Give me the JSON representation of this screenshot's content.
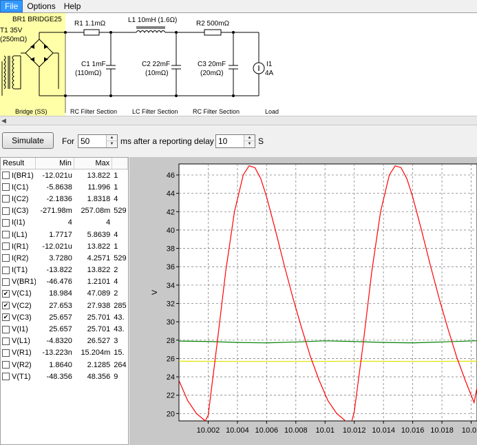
{
  "menu": {
    "file": "File",
    "options": "Options",
    "help": "Help"
  },
  "schematic": {
    "bridge_label": "BR1 BRIDGE25",
    "t1_voltage": "T1 35V",
    "t1_resistance": "(250mΩ)",
    "r1": "R1 1.1mΩ",
    "l1": "L1 10mH (1.6Ω)",
    "r2": "R2 500mΩ",
    "c1_value": "C1 1mF",
    "c1_esr": "(110mΩ)",
    "c2_value": "C2 22mF",
    "c2_esr": "(10mΩ)",
    "c3_value": "C3 20mF",
    "c3_esr": "(20mΩ)",
    "i1_name": "I1",
    "i1_value": "4A",
    "section_bridge": "Bridge (SS)",
    "section_rc1": "RC Filter Section",
    "section_lc": "LC Filter Section",
    "section_rc2": "RC Filter Section",
    "section_load": "Load"
  },
  "controls": {
    "simulate": "Simulate",
    "for_label": "For",
    "duration": "50",
    "ms_label": "ms",
    "delay_label": "after a reporting delay of",
    "delay": "10",
    "s_label": "S"
  },
  "results": {
    "headers": {
      "name": "Result",
      "min": "Min",
      "max": "Max"
    },
    "rows": [
      {
        "name": "I(BR1)",
        "min": "-12.021u",
        "max": "13.822",
        "extra": "1",
        "checked": false
      },
      {
        "name": "I(C1)",
        "min": "-5.8638",
        "max": "11.996",
        "extra": "1",
        "checked": false
      },
      {
        "name": "I(C2)",
        "min": "-2.1836",
        "max": "1.8318",
        "extra": "4",
        "checked": false
      },
      {
        "name": "I(C3)",
        "min": "-271.98m",
        "max": "257.08m",
        "extra": "529",
        "checked": false
      },
      {
        "name": "I(I1)",
        "min": "4",
        "max": "4",
        "extra": "",
        "checked": false
      },
      {
        "name": "I(L1)",
        "min": "1.7717",
        "max": "5.8639",
        "extra": "4",
        "checked": false
      },
      {
        "name": "I(R1)",
        "min": "-12.021u",
        "max": "13.822",
        "extra": "1",
        "checked": false
      },
      {
        "name": "I(R2)",
        "min": "3.7280",
        "max": "4.2571",
        "extra": "529",
        "checked": false
      },
      {
        "name": "I(T1)",
        "min": "-13.822",
        "max": "13.822",
        "extra": "2",
        "checked": false
      },
      {
        "name": "V(BR1)",
        "min": "-46.476",
        "max": "1.2101",
        "extra": "4",
        "checked": false
      },
      {
        "name": "V(C1)",
        "min": "18.984",
        "max": "47.089",
        "extra": "2",
        "checked": true
      },
      {
        "name": "V(C2)",
        "min": "27.653",
        "max": "27.938",
        "extra": "285",
        "checked": true
      },
      {
        "name": "V(C3)",
        "min": "25.657",
        "max": "25.701",
        "extra": "43.",
        "checked": true
      },
      {
        "name": "V(I1)",
        "min": "25.657",
        "max": "25.701",
        "extra": "43.",
        "checked": false
      },
      {
        "name": "V(L1)",
        "min": "-4.8320",
        "max": "26.527",
        "extra": "3",
        "checked": false
      },
      {
        "name": "V(R1)",
        "min": "-13.223n",
        "max": "15.204m",
        "extra": "15.",
        "checked": false
      },
      {
        "name": "V(R2)",
        "min": "1.8640",
        "max": "2.1285",
        "extra": "264",
        "checked": false
      },
      {
        "name": "V(T1)",
        "min": "-48.356",
        "max": "48.356",
        "extra": "9",
        "checked": false
      }
    ]
  },
  "chart_data": {
    "type": "line",
    "ylabel": "V",
    "xlabel": "",
    "xlim": [
      10.0,
      10.0204
    ],
    "ylim": [
      19.2,
      47.2
    ],
    "x_ticks": [
      "10.002",
      "10.004",
      "10.006",
      "10.008",
      "10.01",
      "10.012",
      "10.014",
      "10.016",
      "10.018",
      "10.02"
    ],
    "y_ticks": [
      "20",
      "22",
      "24",
      "26",
      "28",
      "30",
      "32",
      "34",
      "36",
      "38",
      "40",
      "42",
      "44",
      "46"
    ],
    "grid": true,
    "series": [
      {
        "color": "#ff0000",
        "x": [
          10.0,
          10.0006,
          10.0012,
          10.0018,
          10.002,
          10.0026,
          10.0032,
          10.0038,
          10.0044,
          10.0048,
          10.0052,
          10.0056,
          10.006,
          10.0066,
          10.0072,
          10.0078,
          10.0084,
          10.009,
          10.0096,
          10.0102,
          10.0108,
          10.0114,
          10.0118,
          10.012,
          10.0126,
          10.0132,
          10.0138,
          10.0144,
          10.0148,
          10.0152,
          10.0156,
          10.016,
          10.0166,
          10.0172,
          10.0178,
          10.0184,
          10.019,
          10.0196,
          10.0202,
          10.0204
        ],
        "y": [
          23.6,
          21.4,
          20.0,
          19.2,
          19.8,
          27.5,
          35.5,
          42.0,
          46.0,
          47.0,
          46.8,
          45.6,
          43.6,
          40.0,
          36.2,
          32.6,
          29.3,
          26.2,
          23.6,
          21.4,
          20.0,
          19.2,
          19.0,
          20.2,
          27.5,
          35.5,
          42.0,
          46.0,
          47.0,
          46.8,
          45.6,
          43.6,
          40.0,
          36.2,
          32.6,
          29.3,
          26.2,
          23.6,
          21.2,
          22.8
        ]
      },
      {
        "color": "#008000",
        "x": [
          10.0,
          10.002,
          10.004,
          10.006,
          10.008,
          10.01,
          10.012,
          10.014,
          10.016,
          10.018,
          10.0204
        ],
        "y": [
          27.9,
          27.85,
          27.75,
          27.7,
          27.8,
          27.92,
          27.85,
          27.75,
          27.7,
          27.8,
          27.93
        ]
      },
      {
        "color": "#e0e000",
        "x": [
          10.0,
          10.004,
          10.008,
          10.012,
          10.016,
          10.0204
        ],
        "y": [
          25.7,
          25.68,
          25.68,
          25.7,
          25.68,
          25.7
        ]
      }
    ]
  }
}
